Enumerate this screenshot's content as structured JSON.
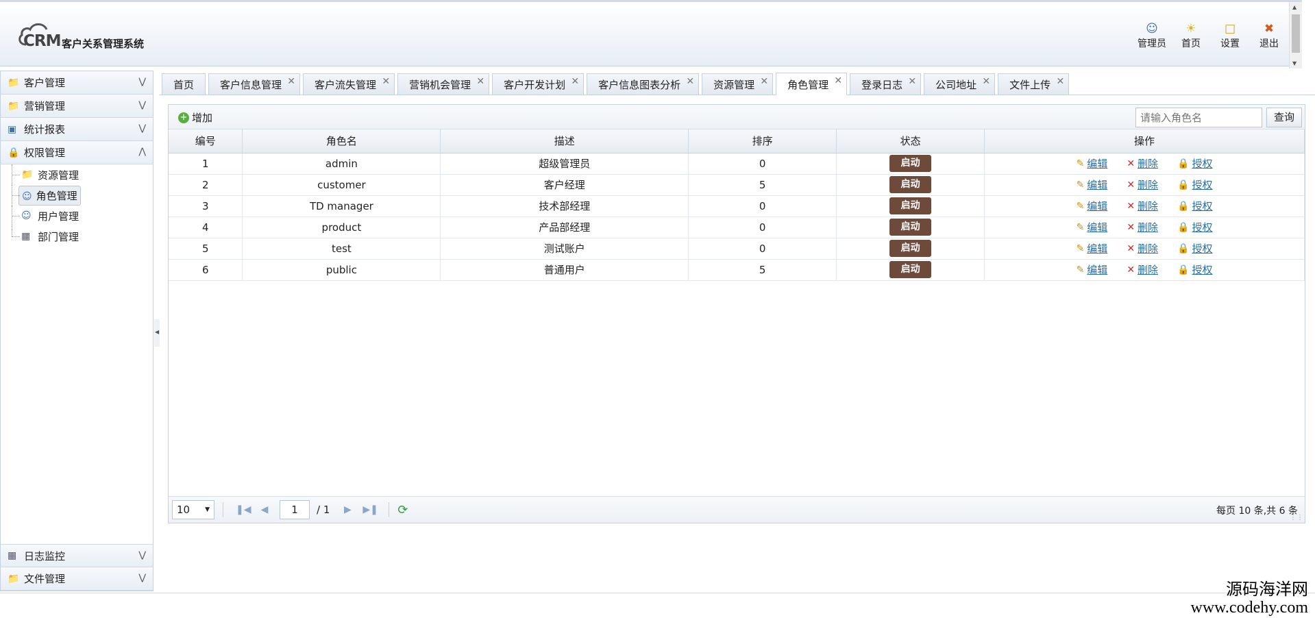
{
  "app": {
    "logo_text": "CRM",
    "system_name": "客户关系管理系统"
  },
  "header_tools": [
    {
      "label": "管理员",
      "icon": "admin-icon"
    },
    {
      "label": "首页",
      "icon": "home-icon"
    },
    {
      "label": "设置",
      "icon": "settings-icon"
    },
    {
      "label": "退出",
      "icon": "logout-icon"
    }
  ],
  "sidebar": {
    "top": [
      {
        "label": "客户管理",
        "icon": "folder-icon"
      },
      {
        "label": "营销管理",
        "icon": "folder-icon"
      },
      {
        "label": "统计报表",
        "icon": "report-icon"
      },
      {
        "label": "权限管理",
        "icon": "lock-icon"
      }
    ],
    "tree": [
      {
        "label": "资源管理",
        "icon": "folder-icon"
      },
      {
        "label": "角色管理",
        "icon": "user-icon"
      },
      {
        "label": "用户管理",
        "icon": "user-icon"
      },
      {
        "label": "部门管理",
        "icon": "department-icon"
      }
    ],
    "bottom": [
      {
        "label": "日志监控",
        "icon": "monitor-icon"
      },
      {
        "label": "文件管理",
        "icon": "folder-icon"
      }
    ]
  },
  "tabs": [
    {
      "label": "首页"
    },
    {
      "label": "客户信息管理"
    },
    {
      "label": "客户流失管理"
    },
    {
      "label": "营销机会管理"
    },
    {
      "label": "客户开发计划"
    },
    {
      "label": "客户信息图表分析"
    },
    {
      "label": "资源管理"
    },
    {
      "label": "角色管理"
    },
    {
      "label": "登录日志"
    },
    {
      "label": "公司地址"
    },
    {
      "label": "文件上传"
    }
  ],
  "active_tab": "角色管理",
  "toolbar": {
    "add_label": "增加",
    "search_placeholder": "请输入角色名",
    "query_label": "查询"
  },
  "table": {
    "headers": [
      "编号",
      "角色名",
      "描述",
      "排序",
      "状态",
      "操作"
    ],
    "rows": [
      {
        "id": "1",
        "name": "admin",
        "desc": "超级管理员",
        "order": "0",
        "status": "启动"
      },
      {
        "id": "2",
        "name": "customer",
        "desc": "客户经理",
        "order": "5",
        "status": "启动"
      },
      {
        "id": "3",
        "name": "TD manager",
        "desc": "技术部经理",
        "order": "0",
        "status": "启动"
      },
      {
        "id": "4",
        "name": "product",
        "desc": "产品部经理",
        "order": "0",
        "status": "启动"
      },
      {
        "id": "5",
        "name": "test",
        "desc": "测试账户",
        "order": "0",
        "status": "启动"
      },
      {
        "id": "6",
        "name": "public",
        "desc": "普通用户",
        "order": "5",
        "status": "启动"
      }
    ],
    "ops": {
      "edit": "编辑",
      "delete": "删除",
      "grant": "授权"
    }
  },
  "pager": {
    "page_size": "10",
    "page": "1",
    "total_pages": "/ 1",
    "info": "每页 10 条,共 6 条"
  },
  "watermark": {
    "line1": "源码海洋网",
    "line2": "www.codehy.com"
  },
  "colors": {
    "status_button": "#6e4a3a",
    "link": "#2a6ea8",
    "border": "#c5d1df"
  }
}
